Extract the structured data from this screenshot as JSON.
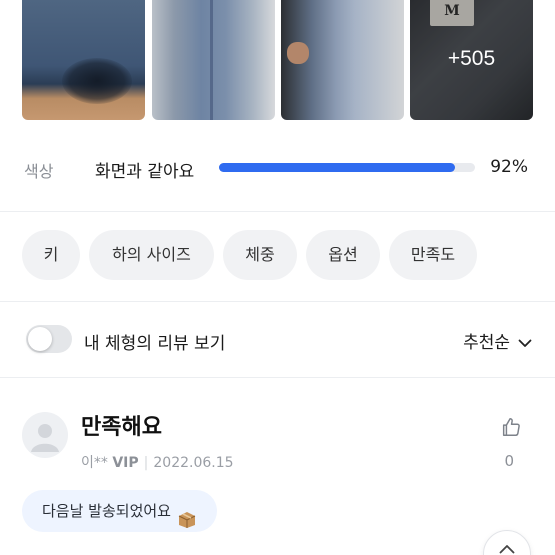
{
  "photos": {
    "more_count": "+505",
    "tag_text": "M"
  },
  "fit": {
    "label": "색상",
    "value": "화면과 같아요",
    "percent_text": "92%",
    "percent": 92
  },
  "chips": [
    "키",
    "하의 사이즈",
    "체중",
    "옵션",
    "만족도"
  ],
  "filter": {
    "toggle_label": "내 체형의 리뷰 보기",
    "toggle_on": false,
    "sort_label": "추천순"
  },
  "review": {
    "title": "만족해요",
    "author": "이**",
    "grade": "VIP",
    "date": "2022.06.15",
    "likes": "0",
    "tag_text": "다음날 발송되었어요"
  },
  "colors": {
    "accent": "#2f6bf0",
    "chip_bg": "#f1f2f4",
    "bubble_bg": "#eef4ff"
  }
}
